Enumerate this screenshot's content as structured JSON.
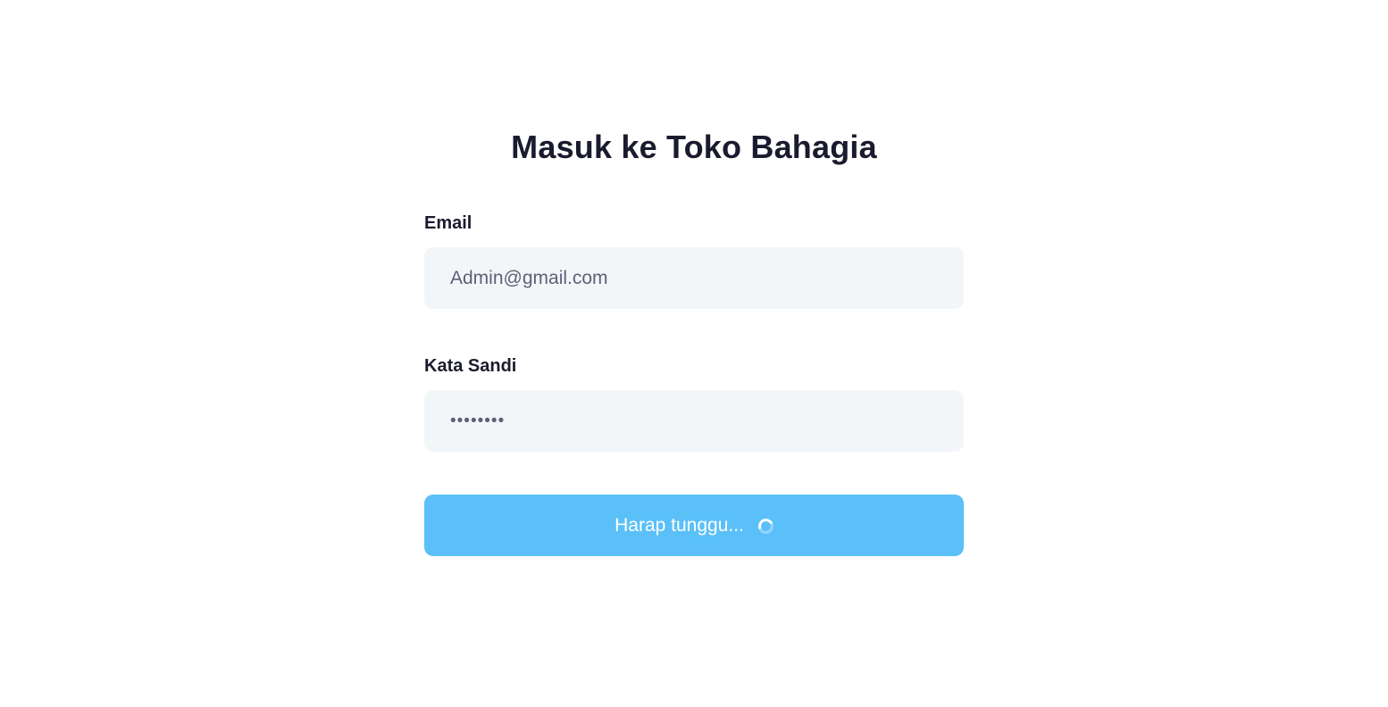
{
  "page": {
    "title": "Masuk ke Toko Bahagia"
  },
  "form": {
    "email_label": "Email",
    "email_value": "Admin@gmail.com",
    "password_label": "Kata Sandi",
    "password_value": "••••••••",
    "submit_label": "Harap tunggu..."
  },
  "colors": {
    "button_bg": "#5bc0f8",
    "input_bg": "#f3f6f9",
    "text": "#1a1b2e"
  },
  "icons": {
    "submit_spinner": "loading-spinner-icon"
  }
}
